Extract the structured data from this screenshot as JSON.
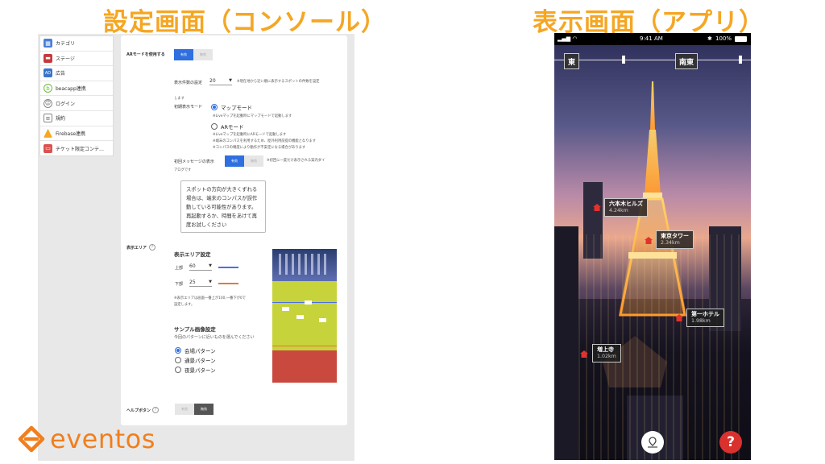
{
  "headings": {
    "console": "設定画面（コンソール）",
    "app": "表示画面（アプリ）"
  },
  "sidebar": {
    "items": [
      {
        "label": "カテゴリ",
        "icon": "category-icon"
      },
      {
        "label": "ステージ",
        "icon": "stage-icon"
      },
      {
        "label": "広告",
        "icon": "ad-icon"
      },
      {
        "label": "beacapp連携",
        "icon": "beacapp-icon"
      },
      {
        "label": "ログイン",
        "icon": "login-icon"
      },
      {
        "label": "規約",
        "icon": "terms-icon"
      },
      {
        "label": "Firebase連携",
        "icon": "firebase-icon"
      },
      {
        "label": "チケット限定コンテ…",
        "icon": "ticket-icon"
      }
    ]
  },
  "console": {
    "ar_mode_label": "ARモードを使用する",
    "toggle_on": "有効",
    "toggle_off": "無効",
    "display_count_label": "表示件数の設定",
    "display_count_value": "20",
    "display_count_note": "※現在地から近い順に表示するスポットの件数を設定",
    "display_count_note2": "します",
    "initial_mode_label": "初期表示モード",
    "map_mode": "マップモード",
    "map_mode_note": "※Liveマップを起動時にマップモードで起動します",
    "ar_mode": "ARモード",
    "ar_mode_note1": "※Liveマップを起動時にARモードで起動します",
    "ar_mode_note2": "※端末のコンパスを利用するため、屋外利用前提の機能となります",
    "ar_mode_note3": "※コンパスの精度により動作が不安定になる場合があります",
    "first_message_label": "初回メッセージの表示",
    "first_message_note": "※初回に一度だけ表示される案内ダイ",
    "first_message_note2": "アログです",
    "message_text": "スポットの方向が大きくずれる場合は、端末のコンパスが誤作動している可能性があります。再起動するか、時間をあけて再度お試しください",
    "area_label": "表示エリア",
    "area_setting_title": "表示エリア設定",
    "upper_label": "上部",
    "upper_value": "60",
    "lower_label": "下部",
    "lower_value": "25",
    "area_note1": "※表示エリアは画面一番上が100,一番下が0で",
    "area_note2": "設定します。",
    "sample_title": "サンプル画像設定",
    "sample_hint": "今回のパターンに近いものを選んでください",
    "patterns": [
      "会場パターン",
      "通景パターン",
      "夜景パターン"
    ],
    "help_button_label": "ヘルプボタン",
    "upper_color": "#4a6fe3",
    "lower_color": "#e07b39"
  },
  "logo": {
    "text": "eventos",
    "color": "#f07f1d"
  },
  "phone": {
    "status": {
      "time": "9:41 AM",
      "battery": "100%"
    },
    "compass": {
      "left": "東",
      "right": "南東"
    },
    "spots": [
      {
        "name": "六本木ヒルズ",
        "distance": "4.24km"
      },
      {
        "name": "東京タワー",
        "distance": "2.34km"
      },
      {
        "name": "第一ホテル",
        "distance": "1.98km"
      },
      {
        "name": "増上寺",
        "distance": "1.02km"
      }
    ],
    "help_glyph": "?"
  }
}
